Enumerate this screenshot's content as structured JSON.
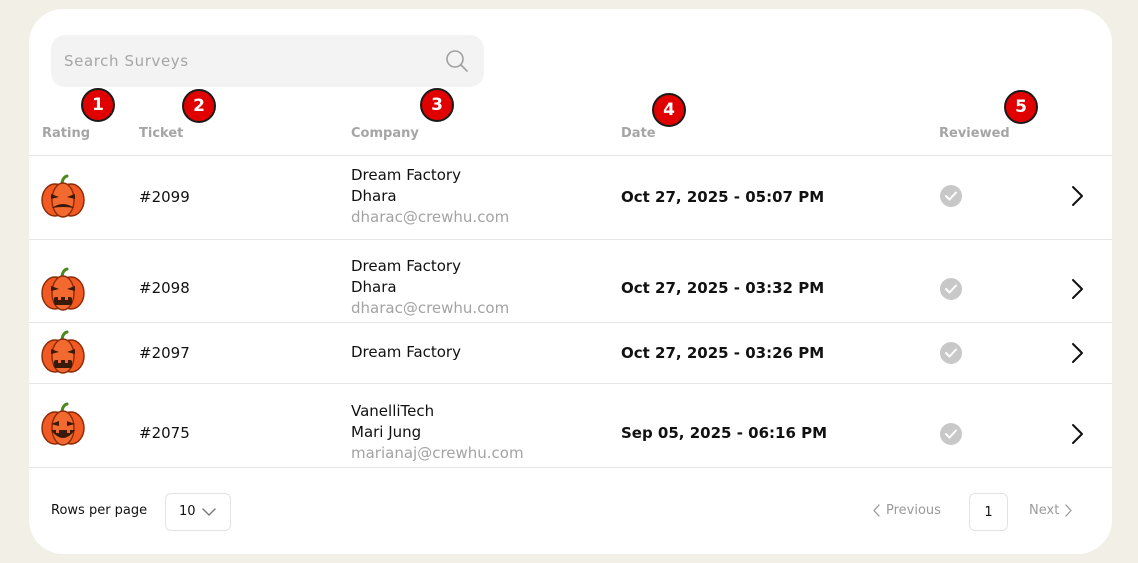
{
  "search": {
    "placeholder": "Search Surveys",
    "icon": "search-icon"
  },
  "markers": [
    "1",
    "2",
    "3",
    "4",
    "5"
  ],
  "columns": {
    "rating": "Rating",
    "ticket": "Ticket",
    "company": "Company",
    "date": "Date",
    "reviewed": "Reviewed"
  },
  "rows": [
    {
      "rating_icon": "pumpkin-frown-icon",
      "ticket": "#2099",
      "company": "Dream Factory",
      "contact": "Dhara",
      "email": "dharac@crewhu.com",
      "date": "Oct 27, 2025 - 05:07 PM",
      "reviewed_icon": "check-circle-icon"
    },
    {
      "rating_icon": "pumpkin-grimace-icon",
      "ticket": "#2098",
      "company": "Dream Factory",
      "contact": "Dhara",
      "email": "dharac@crewhu.com",
      "date": "Oct 27, 2025 - 03:32 PM",
      "reviewed_icon": "check-circle-icon"
    },
    {
      "rating_icon": "pumpkin-grimace-icon",
      "ticket": "#2097",
      "company": "Dream Factory",
      "date": "Oct 27, 2025 - 03:26 PM",
      "reviewed_icon": "check-circle-icon"
    },
    {
      "rating_icon": "pumpkin-grin-icon",
      "ticket": "#2075",
      "company": "VanelliTech",
      "contact": "Mari Jung",
      "email": "marianaj@crewhu.com",
      "date": "Sep 05, 2025 - 06:16 PM",
      "reviewed_icon": "check-circle-icon"
    }
  ],
  "footer": {
    "rows_per_page_label": "Rows per page",
    "rows_per_page_value": "10",
    "previous_label": "Previous",
    "current_page": "1",
    "next_label": "Next"
  },
  "colors": {
    "background": "#f2efe6",
    "marker": "#e00000",
    "pumpkin": "#f15a22",
    "check": "#c8c8c8"
  }
}
